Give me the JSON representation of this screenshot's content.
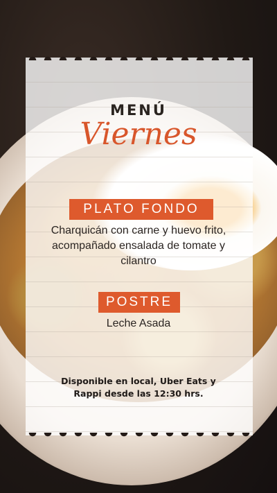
{
  "menu": {
    "heading": "MENÚ",
    "day": "Viernes",
    "main_course": {
      "label": "PLATO FONDO",
      "description": "Charquicán con carne y huevo frito, acompañado ensalada de tomate y cilantro"
    },
    "dessert": {
      "label": "POSTRE",
      "description": "Leche Asada"
    },
    "availability": "Disponible en local, Uber Eats y Rappi desde las 12:30 hrs."
  },
  "colors": {
    "accent": "#de5a2d",
    "script": "#d8562b",
    "text": "#2b2522"
  }
}
